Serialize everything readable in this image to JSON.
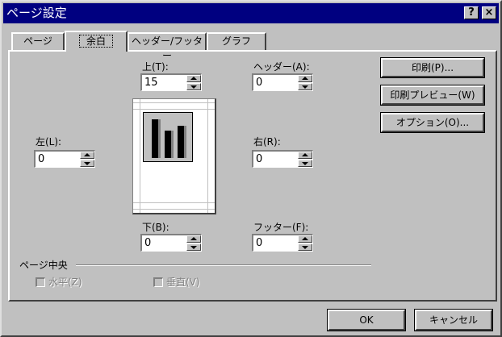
{
  "window": {
    "title": "ページ設定"
  },
  "title_buttons": {
    "help": "?",
    "close": "×"
  },
  "tabs": [
    {
      "label": "ページ"
    },
    {
      "label": "余白"
    },
    {
      "label": "ヘッダー/フッター"
    },
    {
      "label": "グラフ"
    }
  ],
  "margins": {
    "top": {
      "label": "上(T):",
      "value": "15"
    },
    "header": {
      "label": "ヘッダー(A):",
      "value": "0"
    },
    "left": {
      "label": "左(L):",
      "value": "0"
    },
    "right": {
      "label": "右(R):",
      "value": "0"
    },
    "bottom": {
      "label": "下(B):",
      "value": "0"
    },
    "footer": {
      "label": "フッター(F):",
      "value": "0"
    }
  },
  "side_buttons": {
    "print": "印刷(P)...",
    "preview": "印刷プレビュー(W)",
    "options": "オプション(O)..."
  },
  "center_group": {
    "title": "ページ中央",
    "horizontal": "水平(Z)",
    "vertical": "垂直(V)"
  },
  "footer_buttons": {
    "ok": "OK",
    "cancel": "キャンセル"
  },
  "colors": {
    "titlebar": "#000080",
    "face": "#c0c0c0"
  }
}
